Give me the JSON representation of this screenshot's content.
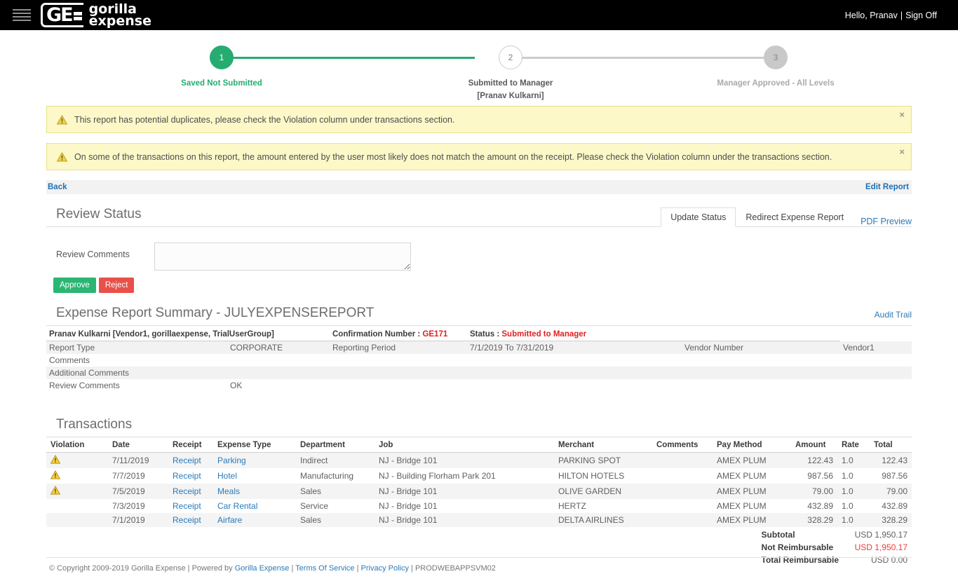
{
  "navbar": {
    "hamburger_icon": "hamburger-menu-icon",
    "logo_mark": "GE",
    "logo_line1": "gorilla",
    "logo_line2": "expense",
    "greeting": "Hello, Pranav",
    "separator": "|",
    "sign_off": "Sign Off"
  },
  "stepper": {
    "steps": [
      {
        "number": "1",
        "label": "Saved Not Submitted",
        "sublabel": "",
        "state": "complete",
        "color": "#26ac70"
      },
      {
        "number": "2",
        "label": "Submitted to Manager",
        "sublabel": "[Pranav Kulkarni]",
        "state": "current",
        "color": "#ffffff"
      },
      {
        "number": "3",
        "label": "Manager Approved - All Levels",
        "sublabel": "",
        "state": "pending",
        "color": "#c9c9c9"
      }
    ]
  },
  "alerts": [
    {
      "icon": "warning-triangle-icon",
      "text": "This report has potential duplicates, please check the Violation column under transactions section.",
      "close": "×"
    },
    {
      "icon": "warning-triangle-icon",
      "text": "On some of the transactions on this report, the amount entered by the user most likely does not match the amount on the receipt. Please check the Violation column under the transactions section.",
      "close": "×"
    }
  ],
  "backbar": {
    "back_label": "Back",
    "edit_report_label": "Edit Report"
  },
  "review_status": {
    "title": "Review Status",
    "tabs": [
      {
        "label": "Update Status",
        "active": true
      },
      {
        "label": "Redirect Expense Report",
        "active": false
      }
    ],
    "pdf_preview_label": "PDF Preview",
    "comments_label": "Review Comments",
    "comments_value": "",
    "comments_placeholder": "",
    "approve_label": "Approve",
    "reject_label": "Reject",
    "approve_color": "#2bb673",
    "reject_color": "#e8504a"
  },
  "summary": {
    "title": "Expense Report Summary - JULYEXPENSEREPORT",
    "audit_trail_label": "Audit Trail",
    "header": {
      "user": "Pranav Kulkarni [Vendor1, gorillaexpense, TrialUserGroup]",
      "confirmation_label": "Confirmation Number :",
      "confirmation_value": "GE171",
      "status_label": "Status :",
      "status_value": "Submitted to Manager"
    },
    "rows": [
      {
        "label": "Report Type",
        "value": "CORPORATE",
        "label2": "Reporting Period",
        "value2": "7/1/2019 To 7/31/2019",
        "label3": "Vendor Number",
        "value3": "Vendor1"
      },
      {
        "label": "Comments",
        "value": "",
        "label2": "",
        "value2": "",
        "label3": "",
        "value3": ""
      },
      {
        "label": "Additional Comments",
        "value": "",
        "label2": "",
        "value2": "",
        "label3": "",
        "value3": ""
      },
      {
        "label": "Review Comments",
        "value": "OK",
        "label2": "",
        "value2": "",
        "label3": "",
        "value3": ""
      }
    ]
  },
  "transactions": {
    "title": "Transactions",
    "columns": [
      "Violation",
      "Date",
      "Receipt",
      "Expense Type",
      "Department",
      "Job",
      "Merchant",
      "Comments",
      "Pay Method",
      "Amount",
      "Rate",
      "Total"
    ],
    "rows": [
      {
        "violation": "warning-triangle-icon",
        "date": "7/11/2019",
        "receipt": "Receipt",
        "expense_type": "Parking",
        "department": "Indirect",
        "job": "NJ - Bridge 101",
        "merchant": "PARKING SPOT",
        "comments": "",
        "pay_method": "AMEX PLUM",
        "amount": "122.43",
        "rate": "1.0",
        "total": "122.43"
      },
      {
        "violation": "warning-triangle-icon",
        "date": "7/7/2019",
        "receipt": "Receipt",
        "expense_type": "Hotel",
        "department": "Manufacturing",
        "job": "NJ - Building Florham Park 201",
        "merchant": "HILTON HOTELS",
        "comments": "",
        "pay_method": "AMEX PLUM",
        "amount": "987.56",
        "rate": "1.0",
        "total": "987.56"
      },
      {
        "violation": "warning-triangle-icon",
        "date": "7/5/2019",
        "receipt": "Receipt",
        "expense_type": "Meals",
        "department": "Sales",
        "job": "NJ - Bridge 101",
        "merchant": "OLIVE GARDEN",
        "comments": "",
        "pay_method": "AMEX PLUM",
        "amount": "79.00",
        "rate": "1.0",
        "total": "79.00"
      },
      {
        "violation": "",
        "date": "7/3/2019",
        "receipt": "Receipt",
        "expense_type": "Car Rental",
        "department": "Service",
        "job": "NJ - Bridge 101",
        "merchant": "HERTZ",
        "comments": "",
        "pay_method": "AMEX PLUM",
        "amount": "432.89",
        "rate": "1.0",
        "total": "432.89"
      },
      {
        "violation": "",
        "date": "7/1/2019",
        "receipt": "Receipt",
        "expense_type": "Airfare",
        "department": "Sales",
        "job": "NJ - Bridge 101",
        "merchant": "DELTA AIRLINES",
        "comments": "",
        "pay_method": "AMEX PLUM",
        "amount": "328.29",
        "rate": "1.0",
        "total": "328.29"
      }
    ],
    "totals": [
      {
        "label": "Subtotal",
        "value": "USD 1,950.17",
        "red": false
      },
      {
        "label": "Not Reimbursable",
        "value": "USD 1,950.17",
        "red": true
      },
      {
        "label": "Total Reimbursable",
        "value": "USD 0.00",
        "red": false
      }
    ]
  },
  "footer": {
    "copyright": "© Copyright 2009-2019 Gorilla Expense | Powered by ",
    "link_gorilla": "Gorilla Expense",
    "sep1": " | ",
    "link_terms": "Terms Of Service",
    "sep2": " | ",
    "link_privacy": "Privacy Policy",
    "sep3": " | ",
    "server": "PRODWEBAPPSVM02"
  }
}
